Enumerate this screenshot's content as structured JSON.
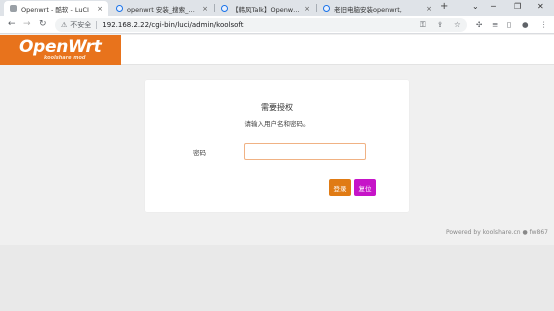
{
  "browser": {
    "tabs": [
      {
        "title": "Openwrt - 酷软 - LuCI",
        "active": true,
        "favicon": "page-icon"
      },
      {
        "title": "openwrt 安装_搜索_哔哩",
        "active": false,
        "favicon": "globe-icon"
      },
      {
        "title": "【韩风Talk】Openwrt科",
        "active": false,
        "favicon": "globe-icon"
      },
      {
        "title": "老旧电脑安装openwrt, ",
        "active": false,
        "favicon": "globe-icon"
      }
    ],
    "close_glyph": "×",
    "new_tab_glyph": "+",
    "address": {
      "security_label": "不安全",
      "url": "192.168.2.22/cgi-bin/luci/admin/koolsoft"
    }
  },
  "header": {
    "logo_text": "OpenWrt",
    "logo_sub": "koolshare mod",
    "brand_color": "#e8731c"
  },
  "login": {
    "heading": "需要授权",
    "subtitle": "请输入用户名和密码。",
    "password_label": "密码",
    "password_value": "",
    "login_button": "登录",
    "reset_button": "复位",
    "login_color": "#e07b14",
    "reset_color": "#c614c8"
  },
  "footer": {
    "powered_by": "Powered by koolshare.cn ● fw867"
  }
}
